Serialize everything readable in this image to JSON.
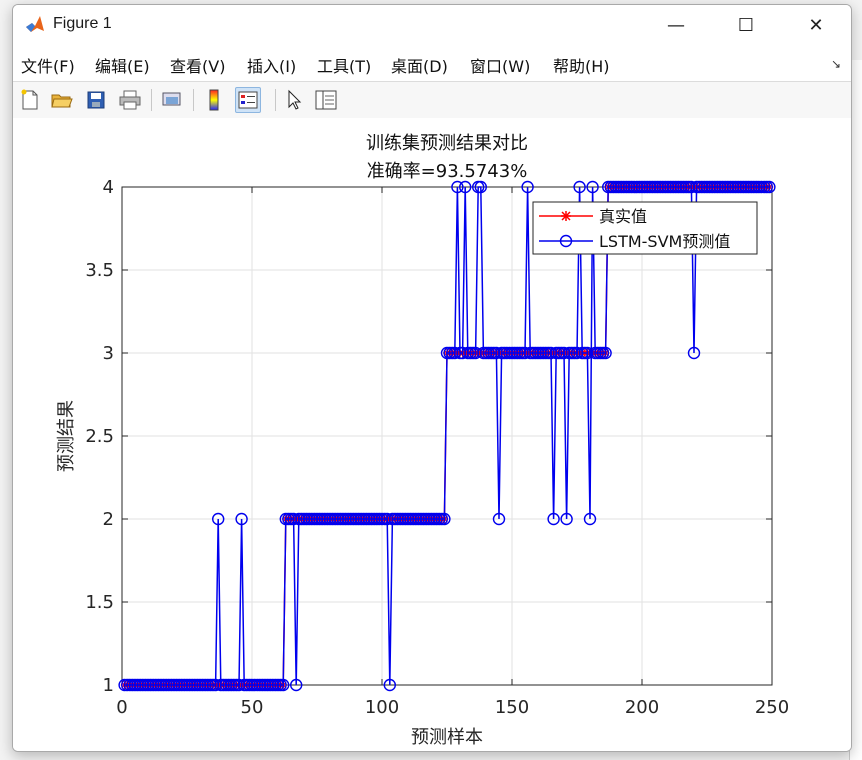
{
  "window": {
    "title": "Figure 1",
    "minimize": "—",
    "maximize": "☐",
    "close": "✕"
  },
  "menu": {
    "items": [
      "文件(F)",
      "编辑(E)",
      "查看(V)",
      "插入(I)",
      "工具(T)",
      "桌面(D)",
      "窗口(W)",
      "帮助(H)"
    ],
    "overflow": "↘"
  },
  "toolbar": {
    "tools": [
      "new-figure-icon",
      "open-folder-icon",
      "save-icon",
      "print-icon",
      "link-icon",
      "colorbar-icon",
      "legend-icon",
      "pointer-icon",
      "property-inspector-icon"
    ]
  },
  "colors": {
    "true_series": "#ff0000",
    "pred_series": "#0000ee",
    "grid": "#e2e2e2"
  },
  "chart_data": {
    "type": "line",
    "title": "训练集预测结果对比",
    "subtitle": "准确率=93.5743%",
    "xlabel": "预测样本",
    "ylabel": "预测结果",
    "xlim": [
      0,
      250
    ],
    "ylim": [
      1,
      4
    ],
    "xticks": [
      0,
      50,
      100,
      150,
      200,
      250
    ],
    "yticks": [
      1,
      1.5,
      2,
      2.5,
      3,
      3.5,
      4
    ],
    "ytick_labels": [
      "1",
      "1.5",
      "2",
      "2.5",
      "3",
      "3.5",
      "4"
    ],
    "grid": true,
    "legend": "top-right",
    "series": [
      {
        "name": "真实值",
        "marker": "asterisk",
        "segments": [
          {
            "x_start": 1,
            "x_end": 62,
            "value": 1
          },
          {
            "x_start": 63,
            "x_end": 124,
            "value": 2
          },
          {
            "x_start": 125,
            "x_end": 186,
            "value": 3
          },
          {
            "x_start": 187,
            "x_end": 249,
            "value": 4
          }
        ]
      },
      {
        "name": "LSTM-SVM预测值",
        "marker": "circle",
        "segments": [
          {
            "x_start": 1,
            "x_end": 62,
            "value": 1
          },
          {
            "x_start": 63,
            "x_end": 124,
            "value": 2
          },
          {
            "x_start": 125,
            "x_end": 186,
            "value": 3
          },
          {
            "x_start": 187,
            "x_end": 249,
            "value": 4
          }
        ],
        "exceptions": [
          {
            "x": 37,
            "value": 2
          },
          {
            "x": 46,
            "value": 2
          },
          {
            "x": 67,
            "value": 1
          },
          {
            "x": 103,
            "value": 1
          },
          {
            "x": 129,
            "value": 4
          },
          {
            "x": 132,
            "value": 4
          },
          {
            "x": 137,
            "value": 4
          },
          {
            "x": 138,
            "value": 4
          },
          {
            "x": 145,
            "value": 2
          },
          {
            "x": 156,
            "value": 4
          },
          {
            "x": 166,
            "value": 2
          },
          {
            "x": 171,
            "value": 2
          },
          {
            "x": 176,
            "value": 4
          },
          {
            "x": 180,
            "value": 2
          },
          {
            "x": 181,
            "value": 4
          },
          {
            "x": 220,
            "value": 3
          }
        ]
      }
    ]
  }
}
